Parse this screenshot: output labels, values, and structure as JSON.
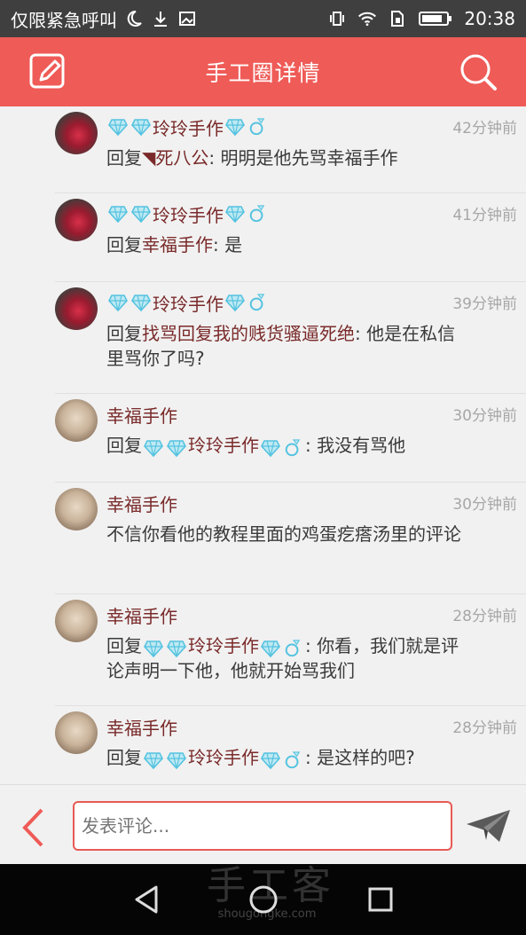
{
  "statusbar": {
    "carrier": "仅限紧急呼叫",
    "time": "20:38",
    "icons": [
      "moon-icon",
      "download-icon",
      "image-icon",
      "vibrate-icon",
      "wifi-icon",
      "sim-icon",
      "battery-icon"
    ]
  },
  "appbar": {
    "title": "手工圈详情",
    "left_icon": "edit-icon",
    "right_icon": "search-icon"
  },
  "colors": {
    "accent": "#ef5b57",
    "statusbar": "#3f3f3f",
    "name": "#7a2a2a",
    "time": "#a7a7a7",
    "badge": "#55c3e0"
  },
  "comments": [
    {
      "user": "玲玲手作",
      "badges_before": 2,
      "badges_after": true,
      "time": "42分钟前",
      "reply_prefix": "回复",
      "reply_to": "◥死八公",
      "body": ": 明明是他先骂幸福手作"
    },
    {
      "user": "玲玲手作",
      "badges_before": 2,
      "badges_after": true,
      "time": "41分钟前",
      "reply_prefix": "回复",
      "reply_to": "幸福手作",
      "body": ": 是"
    },
    {
      "user": "玲玲手作",
      "badges_before": 2,
      "badges_after": true,
      "time": "39分钟前",
      "reply_prefix": "回复",
      "reply_to": "找骂回复我的贱货骚逼死绝",
      "body": ": 他是在私信里骂你了吗?"
    },
    {
      "user": "幸福手作",
      "badges_before": 0,
      "badges_after": false,
      "time": "30分钟前",
      "reply_prefix": "回复",
      "reply_to": "玲玲手作",
      "body": ": 我没有骂他"
    },
    {
      "user": "幸福手作",
      "badges_before": 0,
      "badges_after": false,
      "time": "30分钟前",
      "reply_prefix": "",
      "reply_to": "",
      "body": "不信你看他的教程里面的鸡蛋疙瘩汤里的评论"
    },
    {
      "user": "幸福手作",
      "badges_before": 0,
      "badges_after": false,
      "time": "28分钟前",
      "reply_prefix": "回复",
      "reply_to": "玲玲手作",
      "body": ": 你看，我们就是评论声明一下他，他就开始骂我们"
    },
    {
      "user": "幸福手作",
      "badges_before": 0,
      "badges_after": false,
      "time": "28分钟前",
      "reply_prefix": "回复",
      "reply_to": "玲玲手作",
      "body": ": 是这样的吧?"
    }
  ],
  "composer": {
    "placeholder": "发表评论..."
  },
  "watermark": {
    "main": "手工客",
    "sub": "shougongke.com"
  }
}
